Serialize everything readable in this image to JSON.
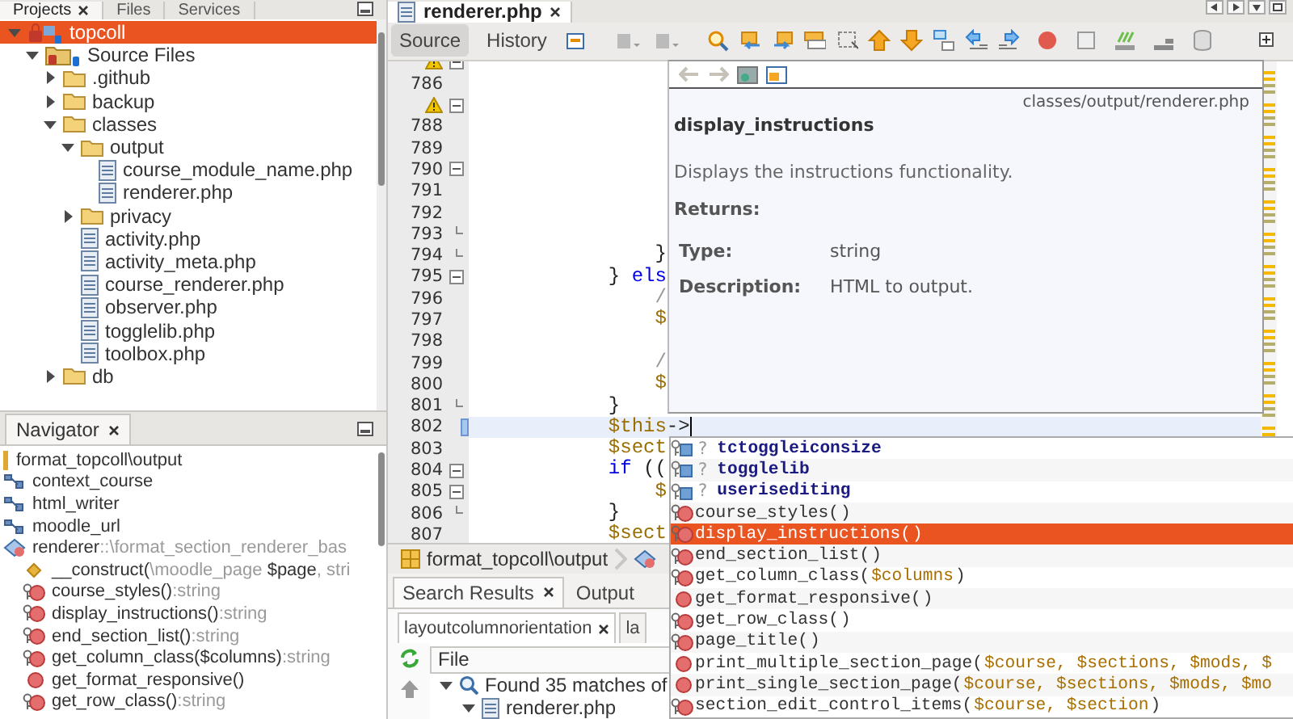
{
  "projects_panel": {
    "tabs": [
      {
        "label": "Projects",
        "selected": true
      },
      {
        "label": "Files",
        "selected": false
      },
      {
        "label": "Services",
        "selected": false
      }
    ],
    "tree": [
      {
        "label": "topcoll",
        "kind": "project",
        "expanded": true,
        "selected": true,
        "children": [
          {
            "label": "Source Files",
            "kind": "sources",
            "expanded": true,
            "selected": false,
            "children": [
              {
                "label": ".github",
                "kind": "folder",
                "expanded": false,
                "selected": false
              },
              {
                "label": "backup",
                "kind": "folder",
                "expanded": false,
                "selected": false
              },
              {
                "label": "classes",
                "kind": "folder",
                "expanded": true,
                "selected": false,
                "children": [
                  {
                    "label": "output",
                    "kind": "folder",
                    "expanded": true,
                    "selected": false,
                    "children": [
                      {
                        "label": "course_module_name.php",
                        "kind": "php",
                        "selected": false
                      },
                      {
                        "label": "renderer.php",
                        "kind": "php",
                        "selected": false
                      }
                    ]
                  },
                  {
                    "label": "privacy",
                    "kind": "folder",
                    "expanded": false,
                    "selected": false
                  },
                  {
                    "label": "activity.php",
                    "kind": "php",
                    "selected": false
                  },
                  {
                    "label": "activity_meta.php",
                    "kind": "php",
                    "selected": false
                  },
                  {
                    "label": "course_renderer.php",
                    "kind": "php",
                    "selected": false
                  },
                  {
                    "label": "observer.php",
                    "kind": "php",
                    "selected": false
                  },
                  {
                    "label": "togglelib.php",
                    "kind": "php",
                    "selected": false
                  },
                  {
                    "label": "toolbox.php",
                    "kind": "php",
                    "selected": false
                  }
                ]
              },
              {
                "label": "db",
                "kind": "folder",
                "expanded": false,
                "selected": false
              }
            ]
          }
        ]
      }
    ]
  },
  "navigator": {
    "title": "Navigator",
    "items": [
      {
        "kind": "namespace",
        "parts": [
          {
            "text": "format_topcoll\\output",
            "dim": false
          }
        ]
      },
      {
        "kind": "use",
        "parts": [
          {
            "text": "context_course",
            "dim": false
          }
        ]
      },
      {
        "kind": "use",
        "parts": [
          {
            "text": "html_writer",
            "dim": false
          }
        ]
      },
      {
        "kind": "use",
        "parts": [
          {
            "text": "moodle_url",
            "dim": false
          }
        ]
      },
      {
        "kind": "class",
        "parts": [
          {
            "text": "renderer",
            "dim": false
          },
          {
            "text": "::\\format_section_renderer_bas",
            "dim": true
          }
        ],
        "children": [
          {
            "kind": "constructor",
            "parts": [
              {
                "text": "__construct(",
                "dim": false
              },
              {
                "text": "\\moodle_page",
                "dim": true
              },
              {
                "text": " $page",
                "dim": false
              },
              {
                "text": ", stri",
                "dim": true
              }
            ]
          },
          {
            "kind": "protected_method",
            "parts": [
              {
                "text": "course_styles()",
                "dim": false
              },
              {
                "text": ":string",
                "dim": true
              }
            ]
          },
          {
            "kind": "protected_method",
            "parts": [
              {
                "text": "display_instructions()",
                "dim": false
              },
              {
                "text": ":string",
                "dim": true
              }
            ]
          },
          {
            "kind": "protected_method",
            "parts": [
              {
                "text": "end_section_list()",
                "dim": false
              },
              {
                "text": ":string",
                "dim": true
              }
            ]
          },
          {
            "kind": "protected_method",
            "parts": [
              {
                "text": "get_column_class($columns)",
                "dim": false
              },
              {
                "text": ":string",
                "dim": true
              }
            ]
          },
          {
            "kind": "public_method",
            "parts": [
              {
                "text": "get_format_responsive()",
                "dim": false
              }
            ]
          },
          {
            "kind": "protected_method",
            "parts": [
              {
                "text": "get_row_class()",
                "dim": false
              },
              {
                "text": ":string",
                "dim": true
              }
            ]
          }
        ]
      }
    ]
  },
  "editor": {
    "file_tabs": [
      {
        "label": "renderer.php",
        "selected": true
      }
    ],
    "views": [
      {
        "label": "Source",
        "selected": true
      },
      {
        "label": "History",
        "selected": false
      }
    ],
    "lines": [
      {
        "kind": "warning",
        "fold_start": true,
        "fold_end": false,
        "current": false
      },
      {
        "kind": "numbered",
        "number": "786",
        "fold_start": false,
        "fold_end": false,
        "current": false
      },
      {
        "kind": "warning",
        "fold_start": true,
        "fold_end": false,
        "current": false
      },
      {
        "kind": "numbered",
        "number": "788",
        "fold_start": false,
        "fold_end": false,
        "current": false
      },
      {
        "kind": "numbered",
        "number": "789",
        "fold_start": false,
        "fold_end": false,
        "current": false
      },
      {
        "kind": "numbered",
        "number": "790",
        "fold_start": true,
        "fold_end": false,
        "current": false
      },
      {
        "kind": "numbered",
        "number": "791",
        "fold_start": false,
        "fold_end": false,
        "current": false
      },
      {
        "kind": "numbered",
        "number": "792",
        "fold_start": false,
        "fold_end": false,
        "current": false
      },
      {
        "kind": "numbered",
        "number": "793",
        "fold_start": false,
        "fold_end": true,
        "current": false
      },
      {
        "kind": "numbered",
        "number": "794",
        "fold_start": false,
        "fold_end": true,
        "current": false,
        "code": [
          {
            "text": "                }",
            "kind": "plain"
          }
        ]
      },
      {
        "kind": "numbered",
        "number": "795",
        "fold_start": true,
        "fold_end": false,
        "current": false,
        "code": [
          {
            "text": "            } ",
            "kind": "plain"
          },
          {
            "text": "els",
            "kind": "keyword"
          }
        ]
      },
      {
        "kind": "numbered",
        "number": "796",
        "fold_start": false,
        "fold_end": false,
        "current": false,
        "code": [
          {
            "text": "                /",
            "kind": "comment"
          }
        ]
      },
      {
        "kind": "numbered",
        "number": "797",
        "fold_start": false,
        "fold_end": false,
        "current": false,
        "code": [
          {
            "text": "                $",
            "kind": "variable"
          }
        ]
      },
      {
        "kind": "numbered",
        "number": "798",
        "fold_start": false,
        "fold_end": false,
        "current": false
      },
      {
        "kind": "numbered",
        "number": "799",
        "fold_start": false,
        "fold_end": false,
        "current": false,
        "code": [
          {
            "text": "                /",
            "kind": "comment"
          }
        ]
      },
      {
        "kind": "numbered",
        "number": "800",
        "fold_start": false,
        "fold_end": false,
        "current": false,
        "code": [
          {
            "text": "                $",
            "kind": "variable"
          }
        ]
      },
      {
        "kind": "numbered",
        "number": "801",
        "fold_start": false,
        "fold_end": true,
        "current": false,
        "code": [
          {
            "text": "            }",
            "kind": "plain"
          }
        ]
      },
      {
        "kind": "numbered",
        "number": "802",
        "fold_start": false,
        "fold_end": false,
        "current": true,
        "code": [
          {
            "text": "            $this",
            "kind": "variable"
          },
          {
            "text": "->",
            "kind": "plain"
          }
        ]
      },
      {
        "kind": "numbered",
        "number": "803",
        "fold_start": false,
        "fold_end": false,
        "current": false,
        "code": [
          {
            "text": "            $sect",
            "kind": "variable"
          }
        ]
      },
      {
        "kind": "numbered",
        "number": "804",
        "fold_start": true,
        "fold_end": false,
        "current": false,
        "code": [
          {
            "text": "            if",
            "kind": "keyword"
          },
          {
            "text": " ((",
            "kind": "plain"
          }
        ]
      },
      {
        "kind": "numbered",
        "number": "805",
        "fold_start": true,
        "fold_end": false,
        "current": false,
        "code": [
          {
            "text": "                $",
            "kind": "variable"
          }
        ]
      },
      {
        "kind": "numbered",
        "number": "806",
        "fold_start": false,
        "fold_end": true,
        "current": false,
        "code": [
          {
            "text": "            }",
            "kind": "plain"
          }
        ]
      },
      {
        "kind": "numbered",
        "number": "807",
        "fold_start": false,
        "fold_end": false,
        "current": false,
        "code": [
          {
            "text": "            $sect",
            "kind": "variable"
          }
        ]
      }
    ],
    "breadcrumb": [
      {
        "label": "format_topcoll\\output"
      }
    ]
  },
  "documentation": {
    "path": "classes/output/renderer.php",
    "title": "display_instructions",
    "description": "Displays the instructions functionality.",
    "returns_label": "Returns:",
    "fields": [
      {
        "label": "Type:",
        "value": "string"
      },
      {
        "label": "Description:",
        "value": "HTML to output."
      }
    ]
  },
  "completion": {
    "items": [
      {
        "kind": "field",
        "type": "?",
        "name": "tctoggleiconsize",
        "selected": false
      },
      {
        "kind": "field",
        "type": "?",
        "name": "togglelib",
        "selected": false
      },
      {
        "kind": "field",
        "type": "?",
        "name": "userisediting",
        "selected": false
      },
      {
        "kind": "protected_method",
        "name": "course_styles(",
        "end": ")",
        "selected": false
      },
      {
        "kind": "protected_method",
        "name": "display_instructions(",
        "end": ")",
        "selected": true
      },
      {
        "kind": "protected_method",
        "name": "end_section_list(",
        "end": ")",
        "selected": false
      },
      {
        "kind": "protected_method",
        "name": "get_column_class(",
        "params": "$columns",
        "end": ")",
        "selected": false
      },
      {
        "kind": "public_method",
        "name": "get_format_responsive(",
        "end": ")",
        "selected": false
      },
      {
        "kind": "protected_method",
        "name": "get_row_class(",
        "end": ")",
        "selected": false
      },
      {
        "kind": "protected_method",
        "name": "page_title(",
        "end": ")",
        "selected": false
      },
      {
        "kind": "public_method",
        "name": "print_multiple_section_page(",
        "params": "$course, $sections, $mods, $",
        "selected": false
      },
      {
        "kind": "public_method",
        "name": "print_single_section_page(",
        "params": "$course, $sections, $mods, $mo",
        "selected": false
      },
      {
        "kind": "protected_method",
        "name": "section_edit_control_items(",
        "params": "$course, $section",
        "end": ")",
        "selected": false
      }
    ]
  },
  "results": {
    "tabs": [
      {
        "label": "Search Results",
        "selected": true
      },
      {
        "label": "Output",
        "selected": false
      }
    ],
    "subtabs": [
      {
        "label": "layoutcolumnorientation",
        "selected": true
      },
      {
        "label": "la",
        "selected": false
      }
    ],
    "column": "File",
    "rows": [
      {
        "label": "Found 35 matches of",
        "kind": "search",
        "expanded": true,
        "children": [
          {
            "label": "renderer.php",
            "kind": "php",
            "expanded": true
          }
        ]
      }
    ]
  }
}
